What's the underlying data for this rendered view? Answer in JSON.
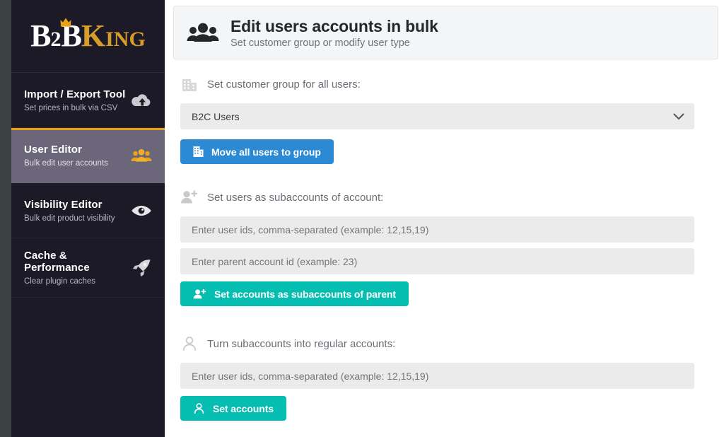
{
  "brand": {
    "part1": "B",
    "part2": "2",
    "part3": "B",
    "part4": "K",
    "part5": "ING",
    "crown_icon": "crown-icon"
  },
  "sidebar": {
    "items": [
      {
        "title": "Import / Export Tool",
        "desc": "Set prices in bulk via CSV",
        "icon": "cloud-upload-icon",
        "active": false
      },
      {
        "title": "User Editor",
        "desc": "Bulk edit user accounts",
        "icon": "users-group-icon",
        "active": true
      },
      {
        "title": "Visibility Editor",
        "desc": "Bulk edit product visibility",
        "icon": "eye-icon",
        "active": false
      },
      {
        "title": "Cache & Performance",
        "desc": "Clear plugin caches",
        "icon": "rocket-icon",
        "active": false
      }
    ]
  },
  "header": {
    "icon": "users-group-icon",
    "title": "Edit users accounts in bulk",
    "subtitle": "Set customer group or modify user type"
  },
  "sections": {
    "customer_group": {
      "icon": "building-icon",
      "label": "Set customer group for all users:",
      "select": {
        "value": "B2C Users",
        "chevron_icon": "chevron-down-icon",
        "options": [
          "B2C Users"
        ]
      },
      "button": {
        "label": "Move all users to group",
        "icon": "building-icon",
        "color": "#2b8ad3"
      }
    },
    "subaccounts": {
      "icon": "user-plus-icon",
      "label": "Set users as subaccounts of account:",
      "input_user_ids": {
        "value": "",
        "placeholder": "Enter user ids, comma-separated (example: 12,15,19)"
      },
      "input_parent_id": {
        "value": "",
        "placeholder": "Enter parent account id (example: 23)"
      },
      "button": {
        "label": "Set accounts as subaccounts of parent",
        "icon": "user-plus-icon",
        "color": "#05bdb0"
      }
    },
    "regular_accounts": {
      "icon": "user-outline-icon",
      "label": "Turn subaccounts into regular accounts:",
      "input_user_ids": {
        "value": "",
        "placeholder": "Enter user ids, comma-separated (example: 12,15,19)"
      },
      "button": {
        "label": "Set accounts",
        "icon": "user-outline-icon",
        "color": "#05bdb0"
      }
    }
  },
  "colors": {
    "accent_gold": "#e8a317",
    "brand_gold": "#d79d2b",
    "sidebar_bg": "#1b1a26",
    "active_item_bg": "#6b6679",
    "primary_blue": "#2b8ad3",
    "teal": "#05bdb0"
  }
}
